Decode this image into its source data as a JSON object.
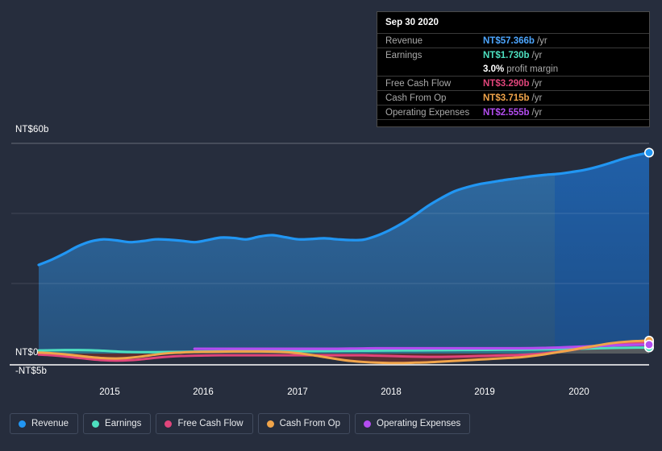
{
  "chart_data": {
    "type": "area",
    "title": "",
    "xlabel": "",
    "ylabel": "",
    "currency_prefix": "NT$",
    "ylim": [
      -5,
      60
    ],
    "y_ticks": [
      {
        "label": "NT$60b",
        "value": 60
      },
      {
        "label": "NT$0",
        "value": 0
      },
      {
        "label": "-NT$5b",
        "value": -5
      }
    ],
    "gridlines": [
      60,
      40,
      20,
      0
    ],
    "grid": true,
    "legend_position": "bottom",
    "x_ticks": [
      "2015",
      "2016",
      "2017",
      "2018",
      "2019",
      "2020"
    ],
    "x_range": [
      "2014-09",
      "2020-09"
    ],
    "series": [
      {
        "name": "Revenue",
        "color": "#2196f3",
        "values": [
          25.3,
          26.8,
          28.6,
          30.6,
          32.0,
          32.6,
          32.3,
          31.8,
          32.1,
          32.6,
          32.5,
          32.2,
          31.8,
          32.4,
          33.1,
          33.0,
          32.6,
          33.4,
          33.8,
          33.2,
          32.6,
          32.7,
          32.9,
          32.6,
          32.4,
          32.5,
          33.6,
          35.2,
          37.2,
          39.6,
          42.2,
          44.4,
          46.3,
          47.5,
          48.4,
          49.0,
          49.6,
          50.1,
          50.6,
          51.0,
          51.3,
          51.8,
          52.4,
          53.3,
          54.4,
          55.6,
          56.6,
          57.366
        ]
      },
      {
        "name": "Earnings",
        "color": "#4de0c0",
        "values": [
          0.9,
          0.95,
          1.0,
          1.0,
          0.95,
          0.8,
          0.6,
          0.45,
          0.4,
          0.4,
          0.45,
          0.5,
          0.55,
          0.6,
          0.65,
          0.7,
          0.7,
          0.7,
          0.7,
          0.7,
          0.7,
          0.7,
          0.72,
          0.75,
          0.78,
          0.8,
          0.82,
          0.85,
          0.88,
          0.9,
          0.92,
          0.95,
          0.98,
          1.0,
          1.02,
          1.05,
          1.08,
          1.1,
          1.15,
          1.2,
          1.28,
          1.35,
          1.42,
          1.5,
          1.58,
          1.64,
          1.69,
          1.73
        ]
      },
      {
        "name": "Free Cash Flow",
        "color": "#e0457b",
        "values": [
          -0.3,
          -0.5,
          -0.8,
          -1.2,
          -1.6,
          -1.9,
          -2.0,
          -1.9,
          -1.6,
          -1.2,
          -0.9,
          -0.7,
          -0.6,
          -0.55,
          -0.5,
          -0.5,
          -0.5,
          -0.5,
          -0.5,
          -0.5,
          -0.5,
          -0.5,
          -0.5,
          -0.5,
          -0.5,
          -0.5,
          -0.6,
          -0.7,
          -0.8,
          -0.9,
          -0.95,
          -0.95,
          -0.9,
          -0.8,
          -0.7,
          -0.6,
          -0.5,
          -0.4,
          -0.2,
          0.1,
          0.5,
          1.0,
          1.6,
          2.1,
          2.6,
          2.9,
          3.1,
          3.29
        ]
      },
      {
        "name": "Cash From Op",
        "color": "#f0a44a",
        "values": [
          0.3,
          0.1,
          -0.2,
          -0.6,
          -1.0,
          -1.3,
          -1.4,
          -1.2,
          -0.8,
          -0.3,
          0.1,
          0.3,
          0.45,
          0.5,
          0.55,
          0.6,
          0.6,
          0.6,
          0.55,
          0.4,
          0.1,
          -0.4,
          -1.0,
          -1.6,
          -2.1,
          -2.4,
          -2.6,
          -2.7,
          -2.7,
          -2.6,
          -2.5,
          -2.3,
          -2.1,
          -1.9,
          -1.7,
          -1.5,
          -1.3,
          -1.1,
          -0.7,
          -0.2,
          0.4,
          1.0,
          1.7,
          2.3,
          2.9,
          3.3,
          3.55,
          3.715
        ]
      },
      {
        "name": "Operating Expenses",
        "color": "#b34df0",
        "values": [
          null,
          null,
          null,
          null,
          null,
          null,
          null,
          null,
          null,
          null,
          null,
          null,
          1.35,
          1.35,
          1.35,
          1.35,
          1.35,
          1.35,
          1.35,
          1.35,
          1.35,
          1.35,
          1.35,
          1.35,
          1.4,
          1.45,
          1.5,
          1.5,
          1.5,
          1.5,
          1.5,
          1.5,
          1.5,
          1.5,
          1.5,
          1.5,
          1.5,
          1.5,
          1.52,
          1.6,
          1.7,
          1.85,
          2.0,
          2.15,
          2.3,
          2.42,
          2.5,
          2.555
        ]
      }
    ]
  },
  "tooltip": {
    "date": "Sep 30 2020",
    "rows": [
      {
        "label": "Revenue",
        "value": "NT$57.366b",
        "unit": "/yr",
        "color": "#4da6ff"
      },
      {
        "label": "Earnings",
        "value": "NT$1.730b",
        "unit": "/yr",
        "color": "#4de0c0"
      },
      {
        "label": "",
        "value": "3.0%",
        "unit": "profit margin",
        "color": "#ffffff"
      },
      {
        "label": "Free Cash Flow",
        "value": "NT$3.290b",
        "unit": "/yr",
        "color": "#e0457b"
      },
      {
        "label": "Cash From Op",
        "value": "NT$3.715b",
        "unit": "/yr",
        "color": "#f0a44a"
      },
      {
        "label": "Operating Expenses",
        "value": "NT$2.555b",
        "unit": "/yr",
        "color": "#b34df0"
      }
    ]
  },
  "legend": {
    "items": [
      {
        "label": "Revenue",
        "color": "#2196f3"
      },
      {
        "label": "Earnings",
        "color": "#4de0c0"
      },
      {
        "label": "Free Cash Flow",
        "color": "#e0457b"
      },
      {
        "label": "Cash From Op",
        "color": "#f0a44a"
      },
      {
        "label": "Operating Expenses",
        "color": "#b34df0"
      }
    ]
  },
  "axes": {
    "y_top_label": "NT$60b",
    "y_zero_label": "NT$0",
    "y_bottom_label": "-NT$5b",
    "x_labels": [
      "2015",
      "2016",
      "2017",
      "2018",
      "2019",
      "2020"
    ]
  }
}
